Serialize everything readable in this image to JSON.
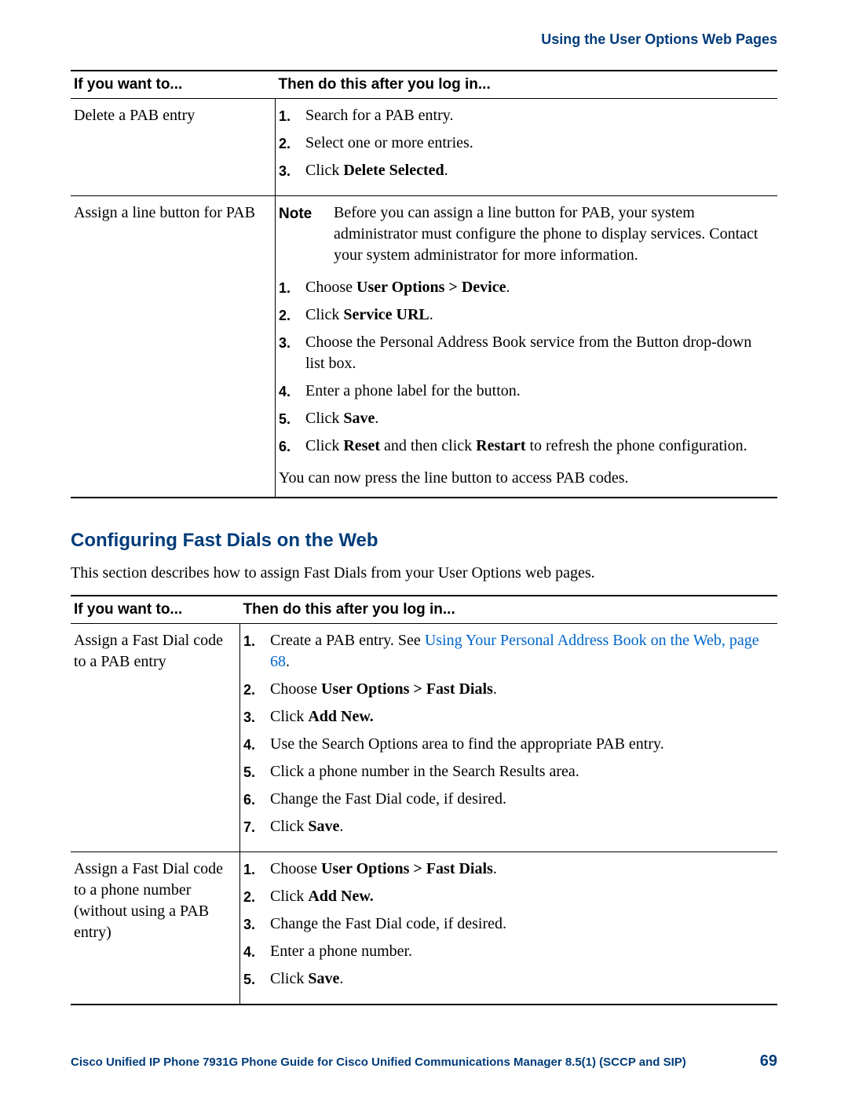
{
  "header": {
    "section_title": "Using the User Options Web Pages"
  },
  "table1": {
    "headers": {
      "col1": "If you want to...",
      "col2": "Then do this after you log in..."
    },
    "rows": [
      {
        "left": "Delete a PAB entry",
        "steps": [
          {
            "n": "1.",
            "parts": [
              "Search for a PAB entry."
            ]
          },
          {
            "n": "2.",
            "parts": [
              "Select one or more entries."
            ]
          },
          {
            "n": "3.",
            "parts": [
              "Click ",
              {
                "b": "Delete Selected"
              },
              "."
            ]
          }
        ]
      },
      {
        "left": "Assign a line button for PAB",
        "note": {
          "label": "Note",
          "text": "Before you can assign a line button for PAB, your system administrator must configure the phone to display services. Contact your system administrator for more information."
        },
        "steps": [
          {
            "n": "1.",
            "parts": [
              "Choose ",
              {
                "b": "User Options > Device"
              },
              "."
            ]
          },
          {
            "n": "2.",
            "parts": [
              "Click ",
              {
                "b": "Service URL"
              },
              "."
            ]
          },
          {
            "n": "3.",
            "parts": [
              "Choose the Personal Address Book service from the Button drop-down list box."
            ]
          },
          {
            "n": "4.",
            "parts": [
              "Enter a phone label for the button."
            ]
          },
          {
            "n": "5.",
            "parts": [
              "Click ",
              {
                "b": "Save"
              },
              "."
            ]
          },
          {
            "n": "6.",
            "parts": [
              "Click ",
              {
                "b": "Reset"
              },
              " and then click ",
              {
                "b": "Restart"
              },
              " to refresh the phone configuration."
            ]
          }
        ],
        "after": "You can now press the line button to access PAB codes."
      }
    ]
  },
  "section2": {
    "heading": "Configuring Fast Dials on the Web",
    "intro": "This section describes how to assign Fast Dials from your User Options web pages."
  },
  "table2": {
    "headers": {
      "col1": "If you want to...",
      "col2": "Then do this after you log in..."
    },
    "rows": [
      {
        "left": "Assign a Fast Dial code to a PAB entry",
        "steps": [
          {
            "n": "1.",
            "parts": [
              "Create a PAB entry. See ",
              {
                "link": "Using Your Personal Address Book on the Web, page 68"
              },
              "."
            ]
          },
          {
            "n": "2.",
            "parts": [
              "Choose ",
              {
                "b": "User Options > Fast Dials"
              },
              "."
            ]
          },
          {
            "n": "3.",
            "parts": [
              "Click ",
              {
                "b": "Add New."
              }
            ]
          },
          {
            "n": "4.",
            "parts": [
              "Use the Search Options area to find the appropriate PAB entry."
            ]
          },
          {
            "n": "5.",
            "parts": [
              "Click a phone number in the Search Results area."
            ]
          },
          {
            "n": "6.",
            "parts": [
              "Change the Fast Dial code, if desired."
            ]
          },
          {
            "n": "7.",
            "parts": [
              "Click ",
              {
                "b": "Save"
              },
              "."
            ]
          }
        ]
      },
      {
        "left": "Assign a Fast Dial code to a phone number (without using a PAB entry)",
        "steps": [
          {
            "n": "1.",
            "parts": [
              "Choose ",
              {
                "b": "User Options > Fast Dials"
              },
              "."
            ]
          },
          {
            "n": "2.",
            "parts": [
              "Click ",
              {
                "b": "Add New."
              }
            ]
          },
          {
            "n": "3.",
            "parts": [
              "Change the Fast Dial code, if desired."
            ]
          },
          {
            "n": "4.",
            "parts": [
              "Enter a phone number."
            ]
          },
          {
            "n": "5.",
            "parts": [
              "Click ",
              {
                "b": "Save"
              },
              "."
            ]
          }
        ]
      }
    ]
  },
  "footer": {
    "title": "Cisco Unified IP Phone 7931G Phone Guide for Cisco Unified Communications Manager 8.5(1) (SCCP and SIP)",
    "page": "69"
  }
}
